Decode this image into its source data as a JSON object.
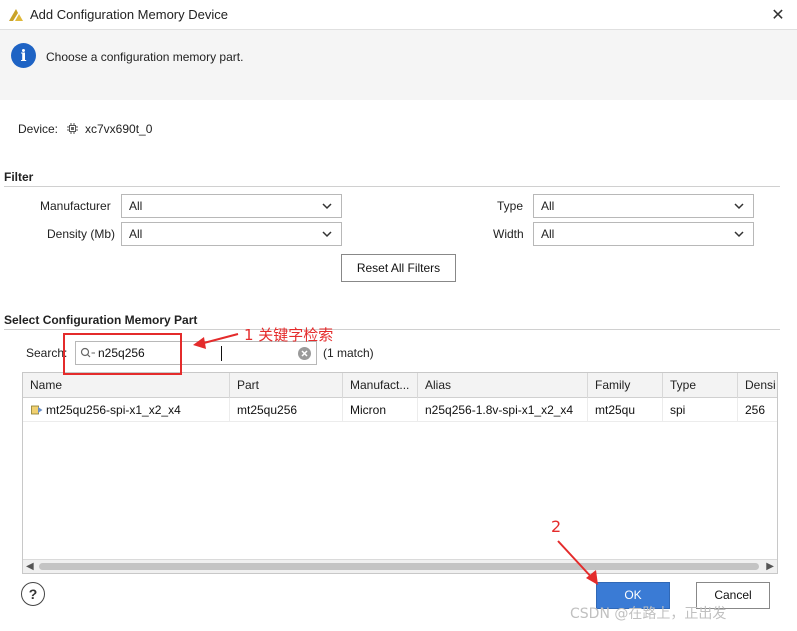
{
  "window": {
    "title": "Add Configuration Memory Device",
    "close_glyph": "✕"
  },
  "info": {
    "glyph": "i",
    "text": "Choose a configuration memory part."
  },
  "device": {
    "label": "Device:",
    "value": "xc7vx690t_0"
  },
  "filter": {
    "section_title": "Filter",
    "manufacturer": {
      "label": "Manufacturer",
      "value": "All"
    },
    "density": {
      "label": "Density (Mb)",
      "value": "All"
    },
    "type": {
      "label": "Type",
      "value": "All"
    },
    "width": {
      "label": "Width",
      "value": "All"
    },
    "reset_label": "Reset All Filters"
  },
  "select_part": {
    "section_title": "Select Configuration Memory Part",
    "search_label": "Search:",
    "search_value": "n25q256",
    "match_text": "(1 match)"
  },
  "table": {
    "columns": [
      "Name",
      "Part",
      "Manufact...",
      "Alias",
      "Family",
      "Type",
      "Densi"
    ],
    "rows": [
      [
        "mt25qu256-spi-x1_x2_x4",
        "mt25qu256",
        "Micron",
        "n25q256-1.8v-spi-x1_x2_x4",
        "mt25qu",
        "spi",
        "256"
      ]
    ]
  },
  "footer": {
    "help_glyph": "?",
    "ok_label": "OK",
    "cancel_label": "Cancel"
  },
  "annotations": {
    "step1": "1 关键字检索",
    "step2": "2",
    "color": "#e42b2b"
  },
  "watermark": "CSDN @在路上，正出发",
  "colors": {
    "accent": "#3a7bd5",
    "info_blue": "#1e63c4"
  }
}
